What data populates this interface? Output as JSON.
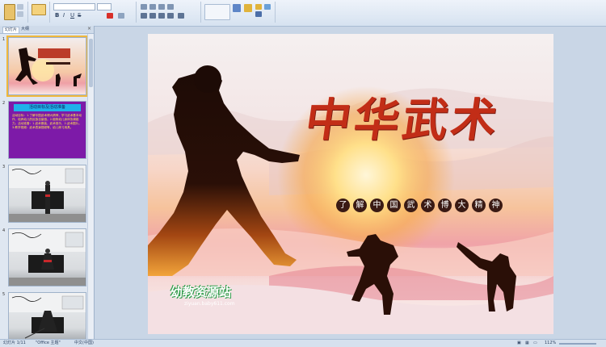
{
  "outline_pane": {
    "tabs": [
      "幻灯片",
      "大纲"
    ],
    "close_glyph": "×",
    "slide_numbers": [
      "1",
      "2",
      "3",
      "4",
      "5"
    ],
    "slide2": {
      "heading": "活动目标及活动准备",
      "body": "活动目标：1.了解中国武术博大精神，学习武术基本动作，培养幼儿的民族自豪感。2.锻炼幼儿身体协调能力。活动准备：1.武术服装，武术音乐，2.武术图片。3.教学视频：武术表演视频等，幼儿练习用具。"
    }
  },
  "slide": {
    "title": "中华武术",
    "subtitle_chars": [
      "了",
      "解",
      "中",
      "国",
      "武",
      "术",
      "博",
      "大",
      "精",
      "神"
    ],
    "logo_text": "幼教资源站",
    "logo_url": "ziyuan.baby611.com"
  },
  "status_bar": {
    "slide_indicator": "幻灯片 1/11",
    "theme": "\"Office 主题\"",
    "language": "中文(中国)",
    "zoom": "112%"
  },
  "colors": {
    "title_red": "#c22d17",
    "chip_dark": "#3a1a14",
    "selected_outline": "#f0b83c"
  }
}
